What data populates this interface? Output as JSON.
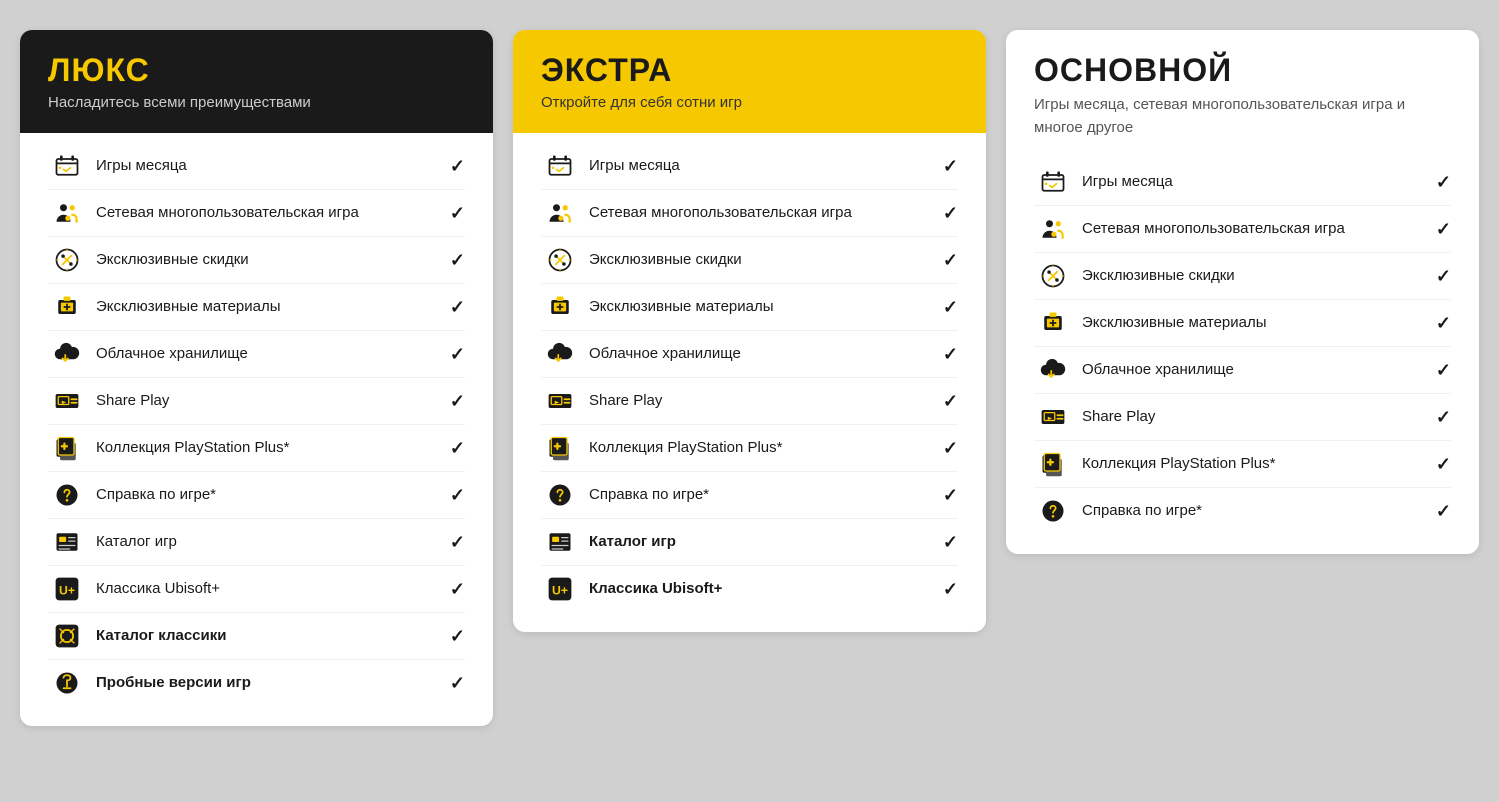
{
  "cards": [
    {
      "id": "luxe",
      "headerClass": "luxe",
      "title": "ЛЮКС",
      "subtitle": "Насладитесь всеми преимуществами",
      "features": [
        {
          "icon": "games-month",
          "label": "Игры месяца",
          "bold": false,
          "check": true
        },
        {
          "icon": "multiplayer",
          "label": "Сетевая многопользовательская игра",
          "bold": false,
          "check": true
        },
        {
          "icon": "discount",
          "label": "Эксклюзивные скидки",
          "bold": false,
          "check": true
        },
        {
          "icon": "materials",
          "label": "Эксклюзивные материалы",
          "bold": false,
          "check": true
        },
        {
          "icon": "cloud",
          "label": "Облачное хранилище",
          "bold": false,
          "check": true
        },
        {
          "icon": "shareplay",
          "label": "Share Play",
          "bold": false,
          "check": true
        },
        {
          "icon": "psplus",
          "label": "Коллекция PlayStation Plus*",
          "bold": false,
          "check": true
        },
        {
          "icon": "hint",
          "label": "Справка по игре*",
          "bold": false,
          "check": true
        },
        {
          "icon": "catalog",
          "label": "Каталог игр",
          "bold": false,
          "check": true
        },
        {
          "icon": "ubisoft",
          "label": "Классика Ubisoft+",
          "bold": false,
          "check": true
        },
        {
          "icon": "classics",
          "label": "Каталог классики",
          "bold": true,
          "check": true
        },
        {
          "icon": "trial",
          "label": "Пробные версии игр",
          "bold": true,
          "check": true
        }
      ]
    },
    {
      "id": "extra",
      "headerClass": "extra",
      "title": "ЭКСТРА",
      "subtitle": "Откройте для себя сотни игр",
      "features": [
        {
          "icon": "games-month",
          "label": "Игры месяца",
          "bold": false,
          "check": true
        },
        {
          "icon": "multiplayer",
          "label": "Сетевая многопользовательская игра",
          "bold": false,
          "check": true
        },
        {
          "icon": "discount",
          "label": "Эксклюзивные скидки",
          "bold": false,
          "check": true
        },
        {
          "icon": "materials",
          "label": "Эксклюзивные материалы",
          "bold": false,
          "check": true
        },
        {
          "icon": "cloud",
          "label": "Облачное хранилище",
          "bold": false,
          "check": true
        },
        {
          "icon": "shareplay",
          "label": "Share Play",
          "bold": false,
          "check": true
        },
        {
          "icon": "psplus",
          "label": "Коллекция PlayStation Plus*",
          "bold": false,
          "check": true
        },
        {
          "icon": "hint",
          "label": "Справка по игре*",
          "bold": false,
          "check": true
        },
        {
          "icon": "catalog",
          "label": "Каталог игр",
          "bold": true,
          "check": true
        },
        {
          "icon": "ubisoft",
          "label": "Классика Ubisoft+",
          "bold": true,
          "check": true
        }
      ]
    },
    {
      "id": "basic",
      "headerClass": "basic",
      "title": "ОСНОВНОЙ",
      "subtitle": "Игры месяца, сетевая многопользовательская игра и многое другое",
      "features": [
        {
          "icon": "games-month",
          "label": "Игры месяца",
          "bold": false,
          "check": true
        },
        {
          "icon": "multiplayer",
          "label": "Сетевая многопользовательская игра",
          "bold": false,
          "check": true
        },
        {
          "icon": "discount",
          "label": "Эксклюзивные скидки",
          "bold": false,
          "check": true
        },
        {
          "icon": "materials",
          "label": "Эксклюзивные материалы",
          "bold": false,
          "check": true
        },
        {
          "icon": "cloud",
          "label": "Облачное хранилище",
          "bold": false,
          "check": true
        },
        {
          "icon": "shareplay",
          "label": "Share Play",
          "bold": false,
          "check": true
        },
        {
          "icon": "psplus",
          "label": "Коллекция PlayStation Plus*",
          "bold": false,
          "check": true
        },
        {
          "icon": "hint",
          "label": "Справка по игре*",
          "bold": false,
          "check": true
        }
      ]
    }
  ]
}
